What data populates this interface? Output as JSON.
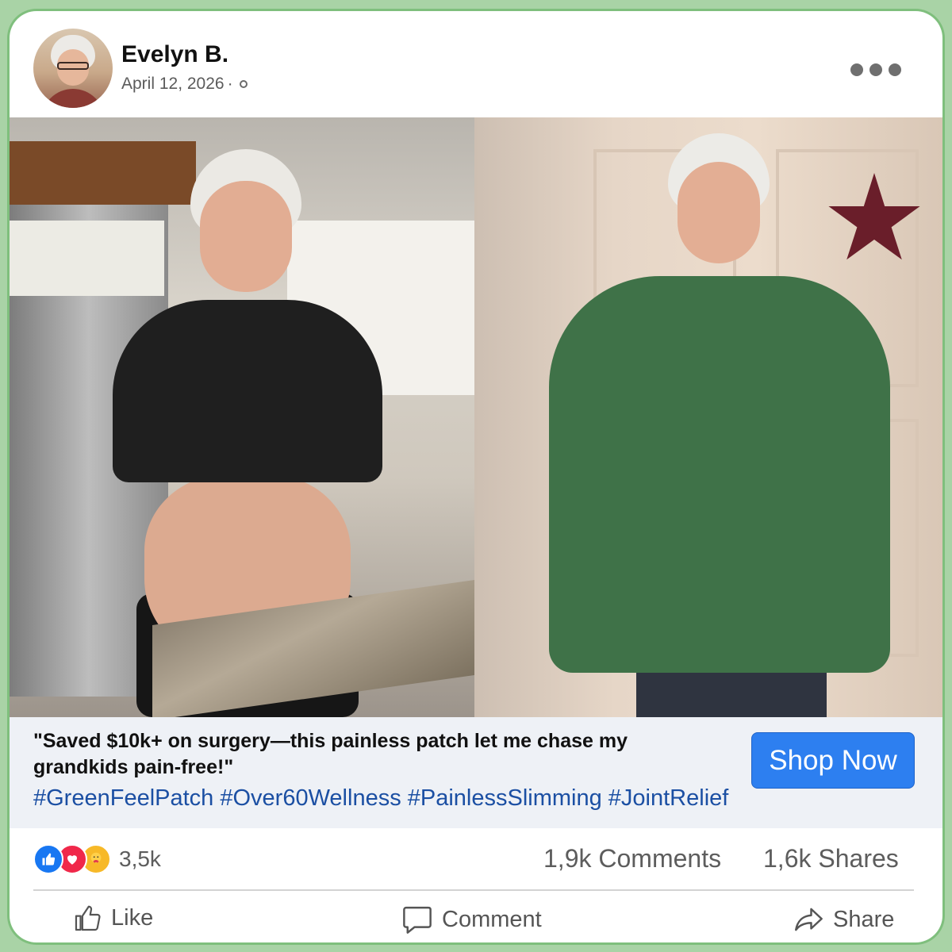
{
  "post": {
    "author": "Evelyn B.",
    "date": "April 12, 2026",
    "date_sep": " ·"
  },
  "caption": {
    "quote": "\"Saved $10k+ on surgery—this painless patch let me chase my grandkids pain-free!\"",
    "hashtags": "#GreenFeelPatch #Over60Wellness #PainlessSlimming #JointRelief",
    "cta_label": "Shop Now"
  },
  "stats": {
    "reactions": "3,5k",
    "comments": "1,9k Comments",
    "shares": "1,6k Shares"
  },
  "actions": {
    "like": "Like",
    "comment": "Comment",
    "share": "Share"
  },
  "icons": {
    "more": "more-options-icon",
    "globe": "globe-icon",
    "like": "thumbs-up-icon",
    "comment": "speech-bubble-icon",
    "share": "share-arrow-icon"
  },
  "colors": {
    "background": "#a9d3a6",
    "cta": "#2d7ff0",
    "hashtag": "#1b4fa3",
    "like_reaction": "#1877f2",
    "love_reaction": "#f0284a",
    "care_reaction": "#f7b928"
  }
}
